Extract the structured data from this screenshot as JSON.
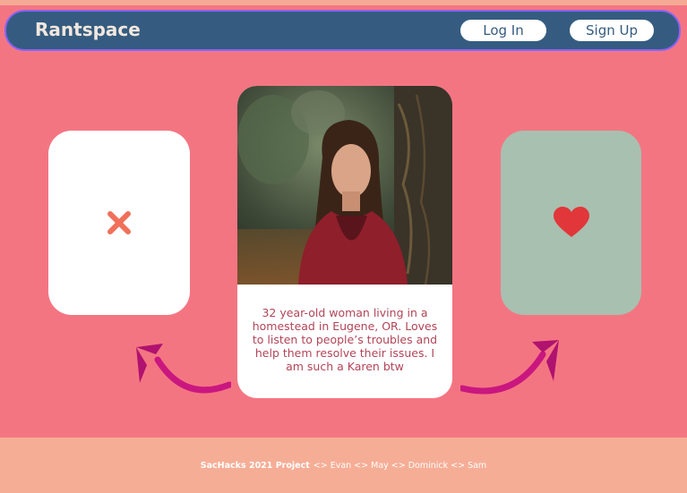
{
  "navbar": {
    "brand": "Rantspace",
    "login_label": "Log In",
    "signup_label": "Sign Up"
  },
  "cards": {
    "reject_icon": "close-x-icon",
    "like_icon": "heart-icon"
  },
  "profile": {
    "bio": "32 year-old woman living in a homestead in Eugene, OR. Loves to listen to people’s troubles and help them resolve their issues. I am such a Karen btw"
  },
  "footer": {
    "project": "SacHacks 2021 Project",
    "credits": "<> Evan <> May <> Dominick <> Sam"
  },
  "colors": {
    "background": "#f47582",
    "navbar": "#355c80",
    "footer": "#f6ad96",
    "like_card": "#a8c0b0",
    "reject_icon": "#f0705a",
    "heart": "#e1373a",
    "arrow": "#c9177f"
  }
}
